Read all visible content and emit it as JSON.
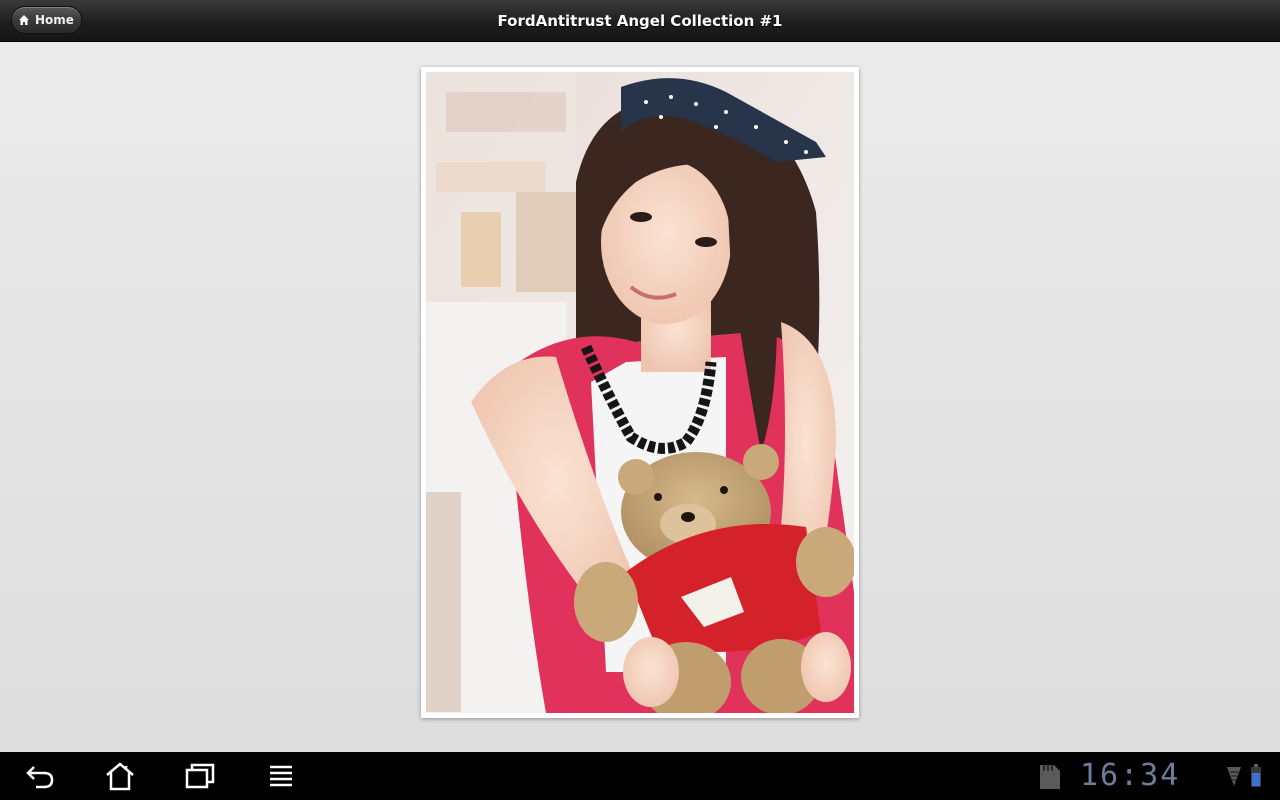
{
  "header": {
    "home_label": "Home",
    "title": "FordAntitrust Angel Collection #1"
  },
  "photo": {
    "alt": "Photo of a young woman with a polka-dot headband holding out a teddy bear in a red sweater"
  },
  "system_bar": {
    "buttons": [
      "back-icon",
      "home-icon",
      "recent-apps-icon",
      "menu-icon"
    ],
    "status_icons": [
      "sd-card-icon",
      "wifi-icon",
      "battery-icon"
    ],
    "time": "16:34"
  },
  "colors": {
    "topbar": "#1f1f1f",
    "background": "#e6e6e6",
    "clock": "#6f7b9a",
    "battery": "#3d6fd6"
  }
}
